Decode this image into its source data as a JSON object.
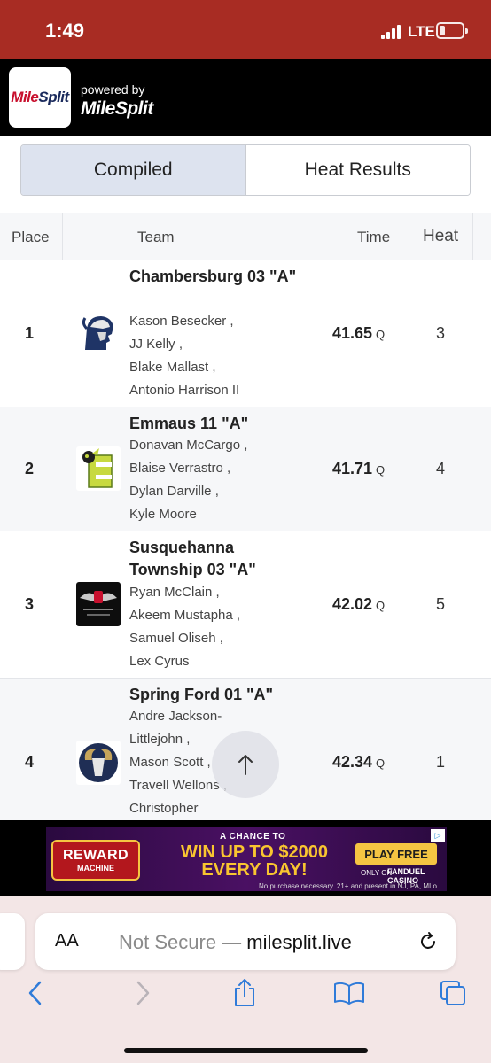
{
  "status_bar": {
    "time": "1:49",
    "network": "LTE"
  },
  "header": {
    "logo_text_red": "Mile",
    "logo_text_blue": "Split",
    "powered_by": "powered by",
    "brand": "MileSplit"
  },
  "tabs": [
    {
      "label": "Compiled",
      "active": true
    },
    {
      "label": "Heat Results",
      "active": false
    }
  ],
  "table": {
    "headers": {
      "place": "Place",
      "team": "Team",
      "time": "Time",
      "heat": "Heat"
    },
    "rows": [
      {
        "place": "1",
        "team": "Chambersburg 03 \"A\"",
        "athletes": [
          "Kason Besecker ,",
          "JJ Kelly ,",
          "Blake Mallast ,",
          "Antonio Harrison II"
        ],
        "time": "41.65",
        "qualifier": "Q",
        "heat": "3",
        "logo_icon": "trojan-head-icon"
      },
      {
        "place": "2",
        "team": "Emmaus 11 \"A\"",
        "athletes": [
          "Donavan McCargo ,",
          "Blaise Verrastro ,",
          "Dylan Darville ,",
          "Kyle Moore"
        ],
        "time": "41.71",
        "qualifier": "Q",
        "heat": "4",
        "logo_icon": "hornet-e-icon"
      },
      {
        "place": "3",
        "team": "Susquehanna Township 03 \"A\"",
        "athletes": [
          "Ryan McClain ,",
          "Akeem Mustapha ,",
          "Samuel Oliseh ,",
          "Lex Cyrus"
        ],
        "time": "42.02",
        "qualifier": "Q",
        "heat": "5",
        "logo_icon": "winged-shoe-icon"
      },
      {
        "place": "4",
        "team": "Spring Ford 01 \"A\"",
        "athletes": [
          "Andre Jackson-",
          "Littlejohn ,",
          "Mason Scott ,",
          "Travell Wellons ,",
          "Christopher"
        ],
        "time": "42.34",
        "qualifier": "Q",
        "heat": "1",
        "logo_icon": "ram-head-icon"
      }
    ]
  },
  "ad": {
    "badge_top": "REWARD",
    "badge_bottom": "MACHINE",
    "chance": "A CHANCE TO",
    "headline_1": "WIN UP TO $2000",
    "headline_2": "EVERY DAY!",
    "cta": "PLAY FREE",
    "only_on": "ONLY ON",
    "fanduel": "FANDUEL CASINO",
    "disclaimer": "No purchase necessary. 21+ and present in NJ, PA, MI o"
  },
  "browser": {
    "text_size": "AA",
    "not_secure": "Not Secure —",
    "domain": "milesplit.live"
  },
  "colors": {
    "status_bar": "#a82c23",
    "header": "#000000",
    "active_tab": "#dde3ef",
    "ios_blue": "#2f7bd9"
  }
}
